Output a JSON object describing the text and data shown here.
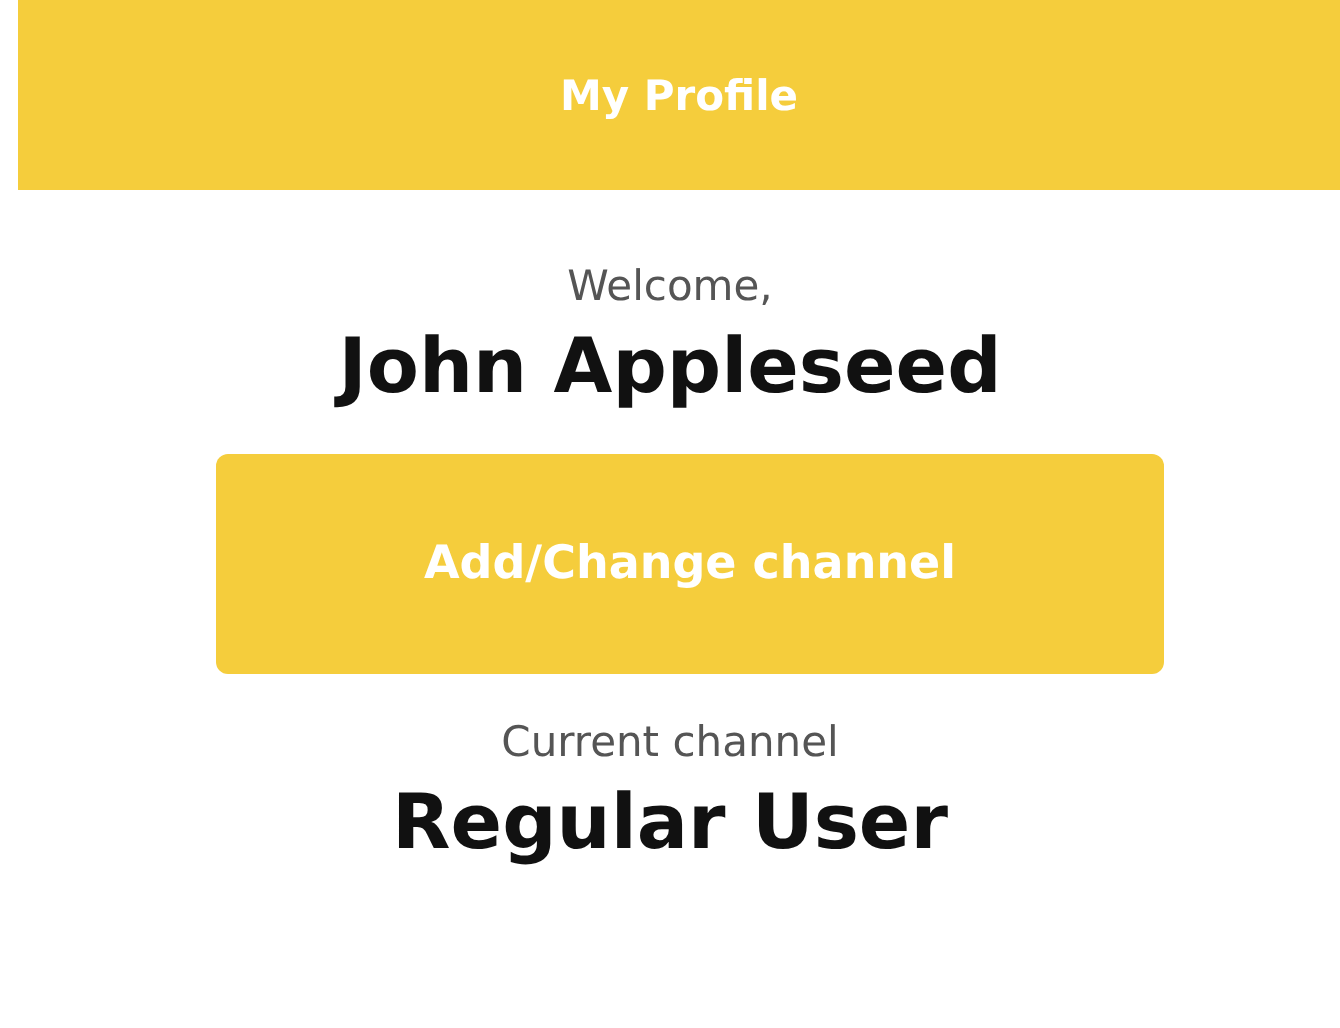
{
  "header": {
    "title": "My Profile"
  },
  "welcome": {
    "greeting": "Welcome,",
    "name": "John Appleseed"
  },
  "button": {
    "label": "Add/Change channel"
  },
  "channel": {
    "label": "Current channel",
    "value": "Regular User"
  }
}
